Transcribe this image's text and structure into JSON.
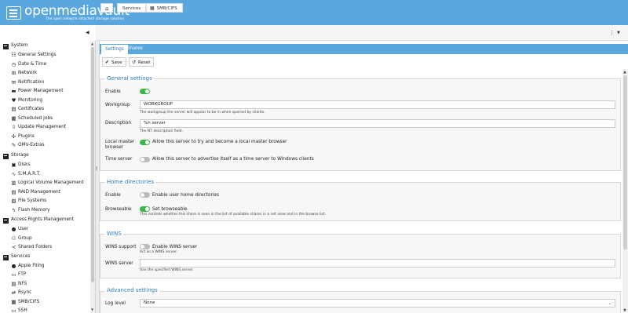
{
  "app": {
    "name": "openmediavault",
    "tagline": "The open network attached storage solution"
  },
  "colors": {
    "header": "#59a7dd",
    "accent": "#2a7ab8",
    "toggle_on": "#3cb64a",
    "toggle_off": "#bbbbbb"
  },
  "breadcrumb": {
    "home_icon": "home-icon",
    "items": [
      "Services",
      "SMB/CIFS"
    ],
    "item_icon": "windows-icon",
    "menu_icon": "kebab-menu-icon"
  },
  "sidebar": {
    "collapse_icon": "chevron-left-icon",
    "groups": [
      {
        "label": "System",
        "items": [
          {
            "label": "General Settings",
            "icon": "sliders-icon"
          },
          {
            "label": "Date & Time",
            "icon": "clock-icon"
          },
          {
            "label": "Network",
            "icon": "network-icon"
          },
          {
            "label": "Notification",
            "icon": "envelope-icon"
          },
          {
            "label": "Power Management",
            "icon": "battery-icon"
          },
          {
            "label": "Monitoring",
            "icon": "heartbeat-icon"
          },
          {
            "label": "Certificates",
            "icon": "certificate-icon"
          },
          {
            "label": "Scheduled Jobs",
            "icon": "calendar-icon"
          },
          {
            "label": "Update Management",
            "icon": "download-icon"
          },
          {
            "label": "Plugins",
            "icon": "puzzle-icon"
          },
          {
            "label": "OMV-Extras",
            "icon": "wrench-icon"
          }
        ]
      },
      {
        "label": "Storage",
        "items": [
          {
            "label": "Disks",
            "icon": "disk-icon"
          },
          {
            "label": "S.M.A.R.T.",
            "icon": "pulse-icon"
          },
          {
            "label": "Logical Volume Management",
            "icon": "layers-icon"
          },
          {
            "label": "RAID Management",
            "icon": "raid-icon"
          },
          {
            "label": "File Systems",
            "icon": "filesystem-icon"
          },
          {
            "label": "Flash Memory",
            "icon": "bolt-icon"
          }
        ]
      },
      {
        "label": "Access Rights Management",
        "items": [
          {
            "label": "User",
            "icon": "user-icon"
          },
          {
            "label": "Group",
            "icon": "users-icon"
          },
          {
            "label": "Shared Folders",
            "icon": "share-icon"
          }
        ]
      },
      {
        "label": "Services",
        "items": [
          {
            "label": "Apple Filing",
            "icon": "apple-icon"
          },
          {
            "label": "FTP",
            "icon": "folder-icon"
          },
          {
            "label": "NFS",
            "icon": "nfs-icon"
          },
          {
            "label": "Rsync",
            "icon": "sync-icon"
          },
          {
            "label": "SMB/CIFS",
            "icon": "windows-icon"
          },
          {
            "label": "SSH",
            "icon": "terminal-icon"
          }
        ]
      }
    ]
  },
  "tabs": [
    {
      "label": "Settings",
      "active": true
    },
    {
      "label": "Shares",
      "active": false
    }
  ],
  "toolbar": {
    "save_label": "Save",
    "reset_label": "Reset"
  },
  "sections": {
    "general": {
      "title": "General settings",
      "enable_label": "Enable",
      "enable_on": true,
      "workgroup_label": "Workgroup",
      "workgroup_value": "WORKGROUP",
      "workgroup_hint": "The workgroup the server will appear to be in when queried by clients.",
      "description_label": "Description",
      "description_value": "%h server",
      "description_hint": "The NT description field.",
      "local_master_label_1": "Local master",
      "local_master_label_2": "browser",
      "local_master_on": true,
      "local_master_text": "Allow this server to try and become a local master browser",
      "time_server_label": "Time server",
      "time_server_on": false,
      "time_server_text": "Allow this server to advertise itself as a time server to Windows clients"
    },
    "home": {
      "title": "Home directories",
      "enable_label": "Enable",
      "enable_on": false,
      "enable_text": "Enable user home directories",
      "browseable_label": "Browseable",
      "browseable_on": true,
      "browseable_text": "Set browseable",
      "browseable_hint": "This controls whether this share is seen in the list of available shares in a net view and in the browse list."
    },
    "wins": {
      "title": "WINS",
      "support_label": "WINS support",
      "support_on": false,
      "support_text": "Enable WINS server",
      "support_hint": "Act as a WINS server.",
      "server_label": "WINS server",
      "server_value": "",
      "server_hint": "Use the specified WINS server."
    },
    "advanced": {
      "title": "Advanced settings",
      "log_level_label": "Log level",
      "log_level_value": "None"
    }
  }
}
